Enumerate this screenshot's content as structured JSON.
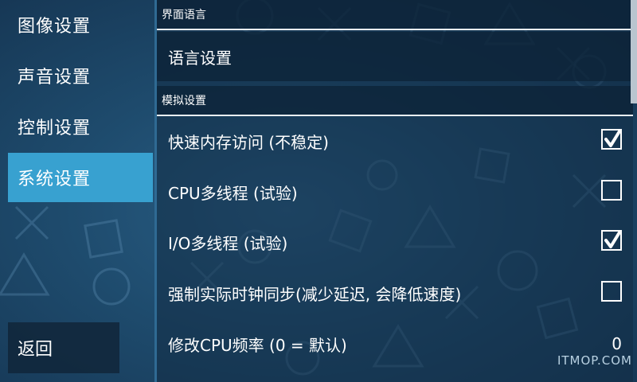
{
  "sidebar": {
    "items": [
      {
        "label": "图像设置",
        "active": false
      },
      {
        "label": "声音设置",
        "active": false
      },
      {
        "label": "控制设置",
        "active": false
      },
      {
        "label": "系统设置",
        "active": true
      }
    ],
    "back_label": "返回"
  },
  "sections": {
    "ui_language": {
      "header": "界面语言",
      "language_label": "语言设置"
    },
    "emulation": {
      "header": "模拟设置",
      "settings": [
        {
          "label": "快速内存访问 (不稳定)",
          "checked": true
        },
        {
          "label": "CPU多线程 (试验)",
          "checked": false
        },
        {
          "label": "I/O多线程 (试验)",
          "checked": true
        },
        {
          "label": "强制实际时钟同步(减少延迟, 会降低速度)",
          "checked": false
        },
        {
          "label": "修改CPU频率 (0 = 默认)",
          "value": "0"
        }
      ]
    }
  },
  "watermark": "ITMOP.COM",
  "colors": {
    "accent": "#38a1d0",
    "background": "#1e4b6d",
    "panel_border": "#2f6a93"
  }
}
